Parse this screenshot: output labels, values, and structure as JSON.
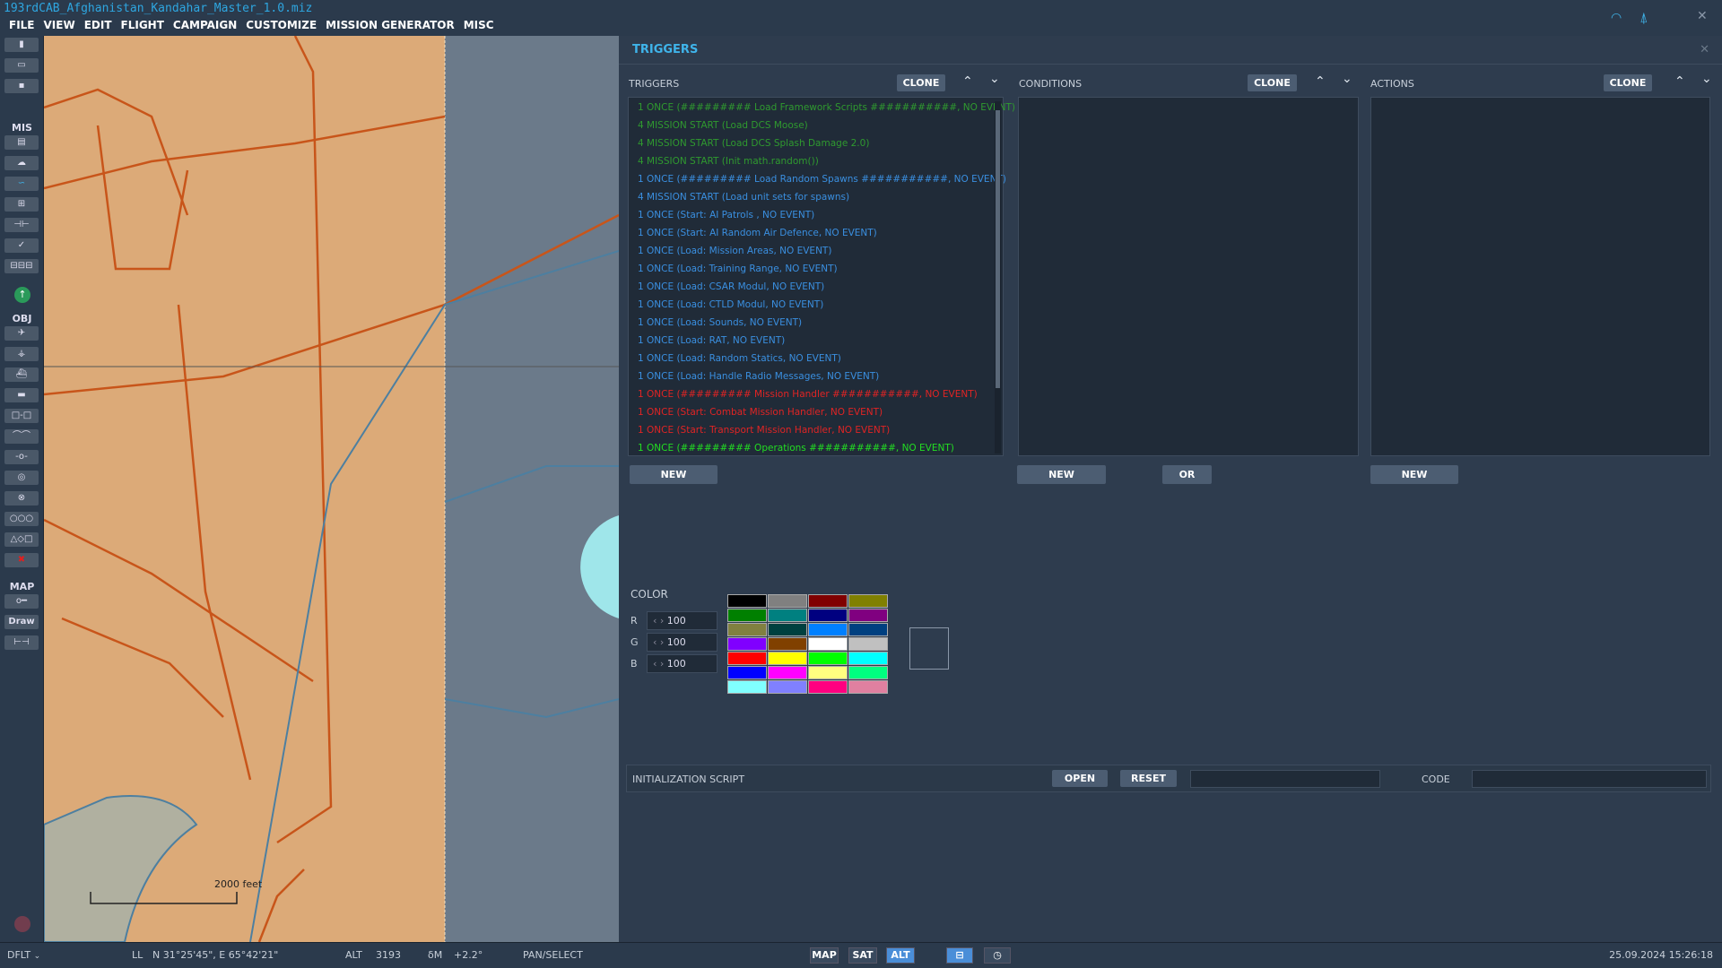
{
  "window": {
    "title": "193rdCAB_Afghanistan_Kandahar_Master_1.0.miz"
  },
  "menu": [
    "FILE",
    "VIEW",
    "EDIT",
    "FLIGHT",
    "CAMPAIGN",
    "CUSTOMIZE",
    "MISSION GENERATOR",
    "MISC"
  ],
  "toolbar": {
    "sections": {
      "mis": "MIS",
      "obj": "OBJ",
      "map": "MAP"
    },
    "draw_label": "Draw"
  },
  "map": {
    "scale_label": "2000 feet",
    "colors": {
      "land": "#dcaa78",
      "sat": "#6b7a8a",
      "roads": "#c8551a"
    }
  },
  "panel": {
    "title": "TRIGGERS",
    "triggers": {
      "label": "TRIGGERS",
      "clone": "CLONE",
      "new": "NEW",
      "items": [
        {
          "text": "1 ONCE (######### Load Framework Scripts ###########, NO EVENT)",
          "color": "#2f9a2f"
        },
        {
          "text": "4 MISSION START (Load DCS Moose)",
          "color": "#2f9a2f"
        },
        {
          "text": "4 MISSION START (Load DCS Splash Damage 2.0)",
          "color": "#2f9a2f"
        },
        {
          "text": "4 MISSION START (Init math.random())",
          "color": "#2f9a2f"
        },
        {
          "text": "1 ONCE (######### Load Random Spawns ###########, NO EVENT)",
          "color": "#3a8fe0"
        },
        {
          "text": "4 MISSION START (Load unit sets for spawns)",
          "color": "#3a8fe0"
        },
        {
          "text": "1 ONCE (Start: AI Patrols , NO EVENT)",
          "color": "#3a8fe0"
        },
        {
          "text": "1 ONCE (Start: AI Random Air Defence, NO EVENT)",
          "color": "#3a8fe0"
        },
        {
          "text": "1 ONCE (Load: Mission Areas, NO EVENT)",
          "color": "#3a8fe0"
        },
        {
          "text": "1 ONCE (Load: Training Range, NO EVENT)",
          "color": "#3a8fe0"
        },
        {
          "text": "1 ONCE (Load: CSAR Modul, NO EVENT)",
          "color": "#3a8fe0"
        },
        {
          "text": "1 ONCE (Load: CTLD Modul, NO EVENT)",
          "color": "#3a8fe0"
        },
        {
          "text": "1 ONCE (Load: Sounds, NO EVENT)",
          "color": "#3a8fe0"
        },
        {
          "text": "1 ONCE (Load: RAT, NO EVENT)",
          "color": "#3a8fe0"
        },
        {
          "text": "1 ONCE (Load: Random Statics, NO EVENT)",
          "color": "#3a8fe0"
        },
        {
          "text": "1 ONCE (Load: Handle Radio Messages, NO EVENT)",
          "color": "#3a8fe0"
        },
        {
          "text": "1 ONCE (######### Mission Handler ###########, NO EVENT)",
          "color": "#e02424"
        },
        {
          "text": "1 ONCE (Start: Combat Mission Handler, NO EVENT)",
          "color": "#e02424"
        },
        {
          "text": "1 ONCE (Start: Transport Mission Handler, NO EVENT)",
          "color": "#e02424"
        },
        {
          "text": "1 ONCE (######### Operations ###########, NO EVENT)",
          "color": "#22dd22"
        }
      ]
    },
    "conditions": {
      "label": "CONDITIONS",
      "clone": "CLONE",
      "new": "NEW",
      "or": "OR"
    },
    "actions": {
      "label": "ACTIONS",
      "clone": "CLONE",
      "new": "NEW"
    },
    "color": {
      "label": "COLOR",
      "r_label": "R",
      "g_label": "G",
      "b_label": "B",
      "r": "100",
      "g": "100",
      "b": "100",
      "palette": [
        "#000000",
        "#808080",
        "#800000",
        "#808000",
        "#008000",
        "#008080",
        "#000080",
        "#800080",
        "#808040",
        "#004040",
        "#0080ff",
        "#004080",
        "#8000ff",
        "#804000",
        "#ffffff",
        "#c0c0c0",
        "#ff0000",
        "#ffff00",
        "#00ff00",
        "#00ffff",
        "#0000ff",
        "#ff00ff",
        "#ffff80",
        "#00ff80",
        "#80ffff",
        "#8080ff",
        "#ff0080",
        "#e080a0"
      ]
    },
    "init": {
      "label": "INITIALIZATION SCRIPT",
      "open": "OPEN",
      "reset": "RESET",
      "code_label": "CODE",
      "script_value": "",
      "code_value": ""
    }
  },
  "status": {
    "profile": "DFLT",
    "ll_label": "LL",
    "coords": "N 31°25'45\", E 65°42'21\"",
    "alt_label": "ALT",
    "alt": "3193",
    "dm_label": "δM",
    "dm": "+2.2°",
    "mode": "PAN/SELECT",
    "map": "MAP",
    "sat": "SAT",
    "alt_btn": "ALT",
    "datetime": "25.09.2024 15:26:18"
  }
}
